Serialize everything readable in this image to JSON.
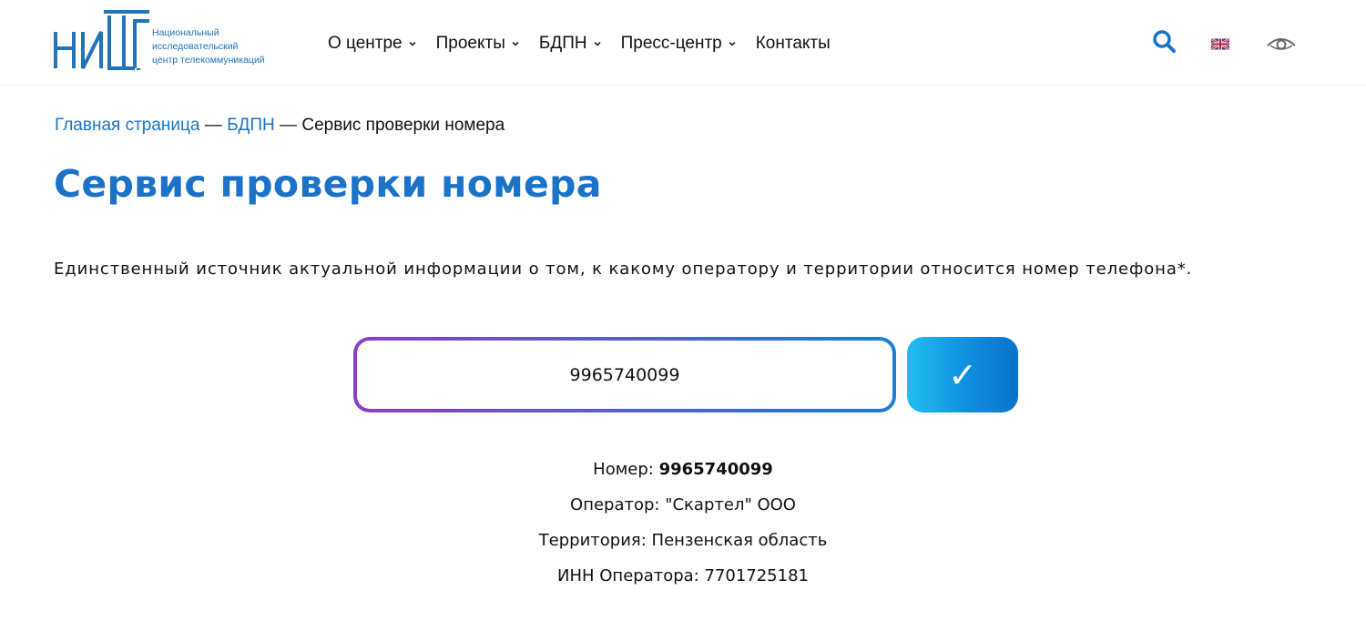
{
  "logo": {
    "mark": "НИЦ",
    "lines": [
      "Национальный",
      "исследовательский",
      "центр телекоммуникаций"
    ]
  },
  "nav": {
    "items": [
      {
        "label": "О центре",
        "has_dropdown": true
      },
      {
        "label": "Проекты",
        "has_dropdown": true
      },
      {
        "label": "БДПН",
        "has_dropdown": true
      },
      {
        "label": "Пресс-центр",
        "has_dropdown": true
      },
      {
        "label": "Контакты",
        "has_dropdown": false
      }
    ]
  },
  "tools": {
    "search_icon": "search-icon",
    "language_icon": "uk-flag-icon",
    "accessibility_icon": "eye-icon"
  },
  "breadcrumb": {
    "home": "Главная страница",
    "sep1": " — ",
    "section": "БДПН",
    "sep2": " — ",
    "current": "Сервис проверки номера"
  },
  "page": {
    "title": "Сервис проверки номера",
    "description": "Единственный источник актуальной информации о том, к какому оператору и территории относится номер телефона*."
  },
  "form": {
    "phone_value": "9965740099",
    "submit_icon": "check-icon",
    "submit_glyph": "✓"
  },
  "result": {
    "number_label": "Номер: ",
    "number_value": "9965740099",
    "operator": "Оператор: \"Скартел\" ООО",
    "territory": "Территория: Пензенская область",
    "inn": "ИНН Оператора: 7701725181"
  },
  "colors": {
    "brand_blue": "#1a73c8",
    "gradient_start": "#8e3ec4",
    "gradient_end": "#1c7fd4",
    "button_start": "#22bdf0",
    "button_end": "#0a72cc"
  }
}
